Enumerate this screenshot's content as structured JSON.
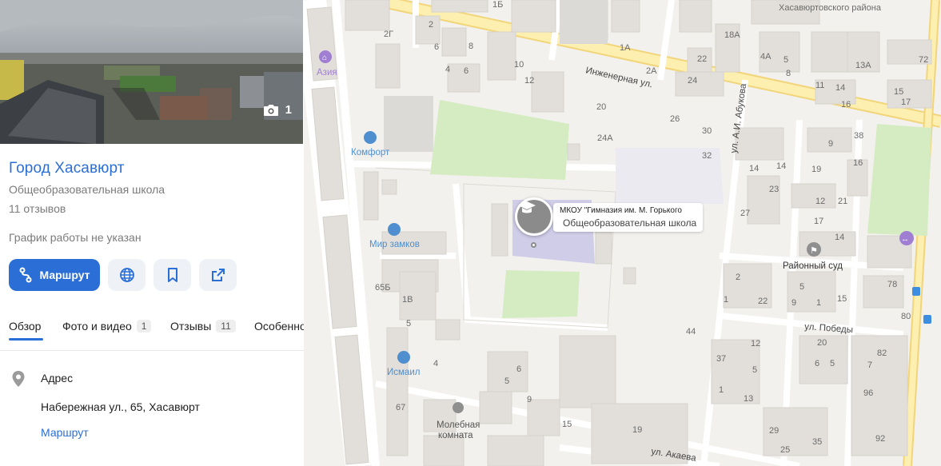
{
  "photo": {
    "count": "1"
  },
  "org": {
    "title": "Город Хасавюрт",
    "category": "Общеобразовательная школа",
    "reviews": "11 отзывов",
    "hours": "График работы не указан"
  },
  "actions": {
    "route_label": "Маршрут"
  },
  "tabs": [
    {
      "label": "Обзор",
      "badge": ""
    },
    {
      "label": "Фото и видео",
      "badge": "1"
    },
    {
      "label": "Отзывы",
      "badge": "11"
    },
    {
      "label": "Особенно",
      "badge": ""
    }
  ],
  "address": {
    "label": "Адрес",
    "value": "Набережная ул., 65, Хасавюрт",
    "route_link": "Маршрут"
  },
  "map": {
    "callout_title": "МКОУ \"Гимназия им. М. Горького",
    "callout_subtitle": "Общеобразовательная школа",
    "streets": {
      "inzhenernaya": "Инженерная ул.",
      "abukova": "ул. А.И. Абукова",
      "pobedy": "ул. Победы",
      "akaeva": "ул. Акаева"
    },
    "district": "Хасавюртовского района",
    "pois": {
      "azia": "Азия",
      "komfort": "Комфорт",
      "mir_zamkov": "Мир замков",
      "ismail": "Исмаил",
      "molebnaya_1": "Молебная",
      "molebnaya_2": "комната",
      "rayonny_sud": "Районный суд"
    },
    "house_numbers": [
      "1Б",
      "2Г",
      "2",
      "6",
      "8",
      "4",
      "6",
      "10",
      "12",
      "1А",
      "2А",
      "20",
      "24А",
      "26",
      "30",
      "32",
      "18А",
      "22",
      "24",
      "4А",
      "5",
      "8",
      "13А",
      "72",
      "15",
      "17",
      "11",
      "14",
      "16",
      "9",
      "38",
      "16",
      "19",
      "12",
      "14",
      "17",
      "21",
      "27",
      "23",
      "1",
      "22",
      "2",
      "5",
      "9",
      "1",
      "15",
      "14",
      "78",
      "80",
      "65Б",
      "1В",
      "44",
      "37",
      "12",
      "5",
      "9",
      "15",
      "19",
      "20",
      "82",
      "96",
      "92",
      "25",
      "29",
      "35",
      "13",
      "67",
      "4",
      "5",
      "9",
      "6"
    ]
  },
  "colors": {
    "accent": "#2b6fd6",
    "park": "#d5ecc2",
    "building": "#e4e2de",
    "road": "#fdf3b8"
  }
}
